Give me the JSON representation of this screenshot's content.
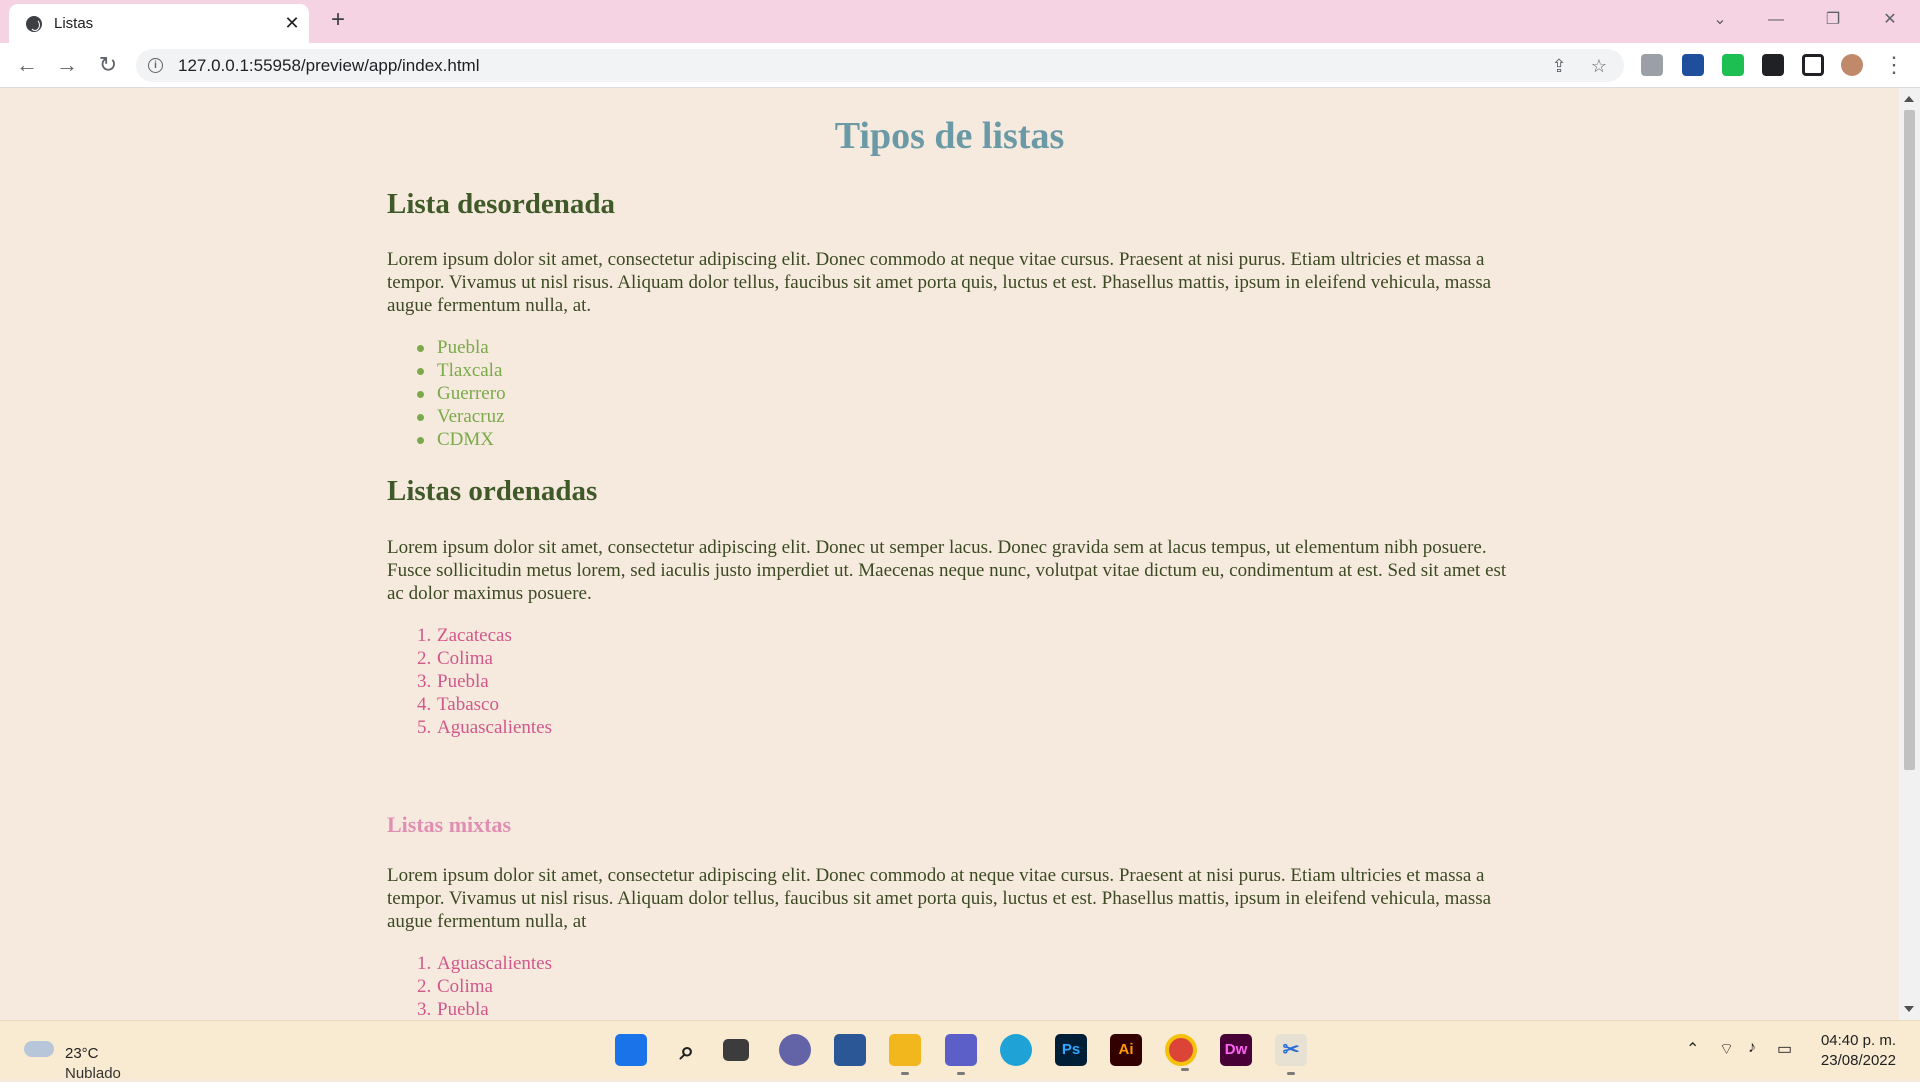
{
  "browser": {
    "tab_title": "Listas",
    "url": "127.0.0.1:55958/preview/app/index.html"
  },
  "page": {
    "title": "Tipos de listas",
    "sections": [
      {
        "heading": "Lista desordenada",
        "paragraph": "Lorem ipsum dolor sit amet, consectetur adipiscing elit. Donec commodo at neque vitae cursus. Praesent at nisi purus. Etiam ultricies et massa a tempor. Vivamus ut nisl risus. Aliquam dolor tellus, faucibus sit amet porta quis, luctus et est. Phasellus mattis, ipsum in eleifend vehicula, massa augue fermentum nulla, at.",
        "items": [
          "Puebla",
          "Tlaxcala",
          "Guerrero",
          "Veracruz",
          "CDMX"
        ]
      },
      {
        "heading": "Listas ordenadas",
        "paragraph": "Lorem ipsum dolor sit amet, consectetur adipiscing elit. Donec ut semper lacus. Donec gravida sem at lacus tempus, ut elementum nibh posuere. Fusce sollicitudin metus lorem, sed iaculis justo imperdiet ut. Maecenas neque nunc, volutpat vitae dictum eu, condimentum at est. Sed sit amet est ac dolor maximus posuere.",
        "items": [
          "Zacatecas",
          "Colima",
          "Puebla",
          "Tabasco",
          "Aguascalientes"
        ]
      },
      {
        "heading": "Listas mixtas",
        "paragraph": "Lorem ipsum dolor sit amet, consectetur adipiscing elit. Donec commodo at neque vitae cursus. Praesent at nisi purus. Etiam ultricies et massa a tempor. Vivamus ut nisl risus. Aliquam dolor tellus, faucibus sit amet porta quis, luctus et est. Phasellus mattis, ipsum in eleifend vehicula, massa augue fermentum nulla, at",
        "items": [
          "Aguascalientes",
          "Colima",
          "Puebla"
        ]
      }
    ]
  },
  "taskbar": {
    "weather_temp": "23°C",
    "weather_condition": "Nublado",
    "time": "04:40 p. m.",
    "date": "23/08/2022",
    "apps": [
      {
        "name": "start-icon",
        "label": ""
      },
      {
        "name": "search-icon",
        "label": ""
      },
      {
        "name": "task-view-icon",
        "label": ""
      },
      {
        "name": "chat-icon",
        "label": ""
      },
      {
        "name": "store-icon",
        "label": ""
      },
      {
        "name": "file-explorer-icon",
        "label": ""
      },
      {
        "name": "teams-icon",
        "label": ""
      },
      {
        "name": "edge-icon",
        "label": ""
      },
      {
        "name": "photoshop-icon",
        "label": "Ps"
      },
      {
        "name": "illustrator-icon",
        "label": "Ai"
      },
      {
        "name": "chrome-icon",
        "label": ""
      },
      {
        "name": "dreamweaver-icon",
        "label": "Dw"
      },
      {
        "name": "snipping-tool-icon",
        "label": ""
      }
    ]
  },
  "colors": {
    "page_bg": "#f6e9dd",
    "title": "#6a9aa6",
    "heading": "#3f5a28",
    "mixed_heading": "#e08fb3",
    "unordered_items": "#7aaa4a",
    "ordered_items": "#d0588c"
  }
}
